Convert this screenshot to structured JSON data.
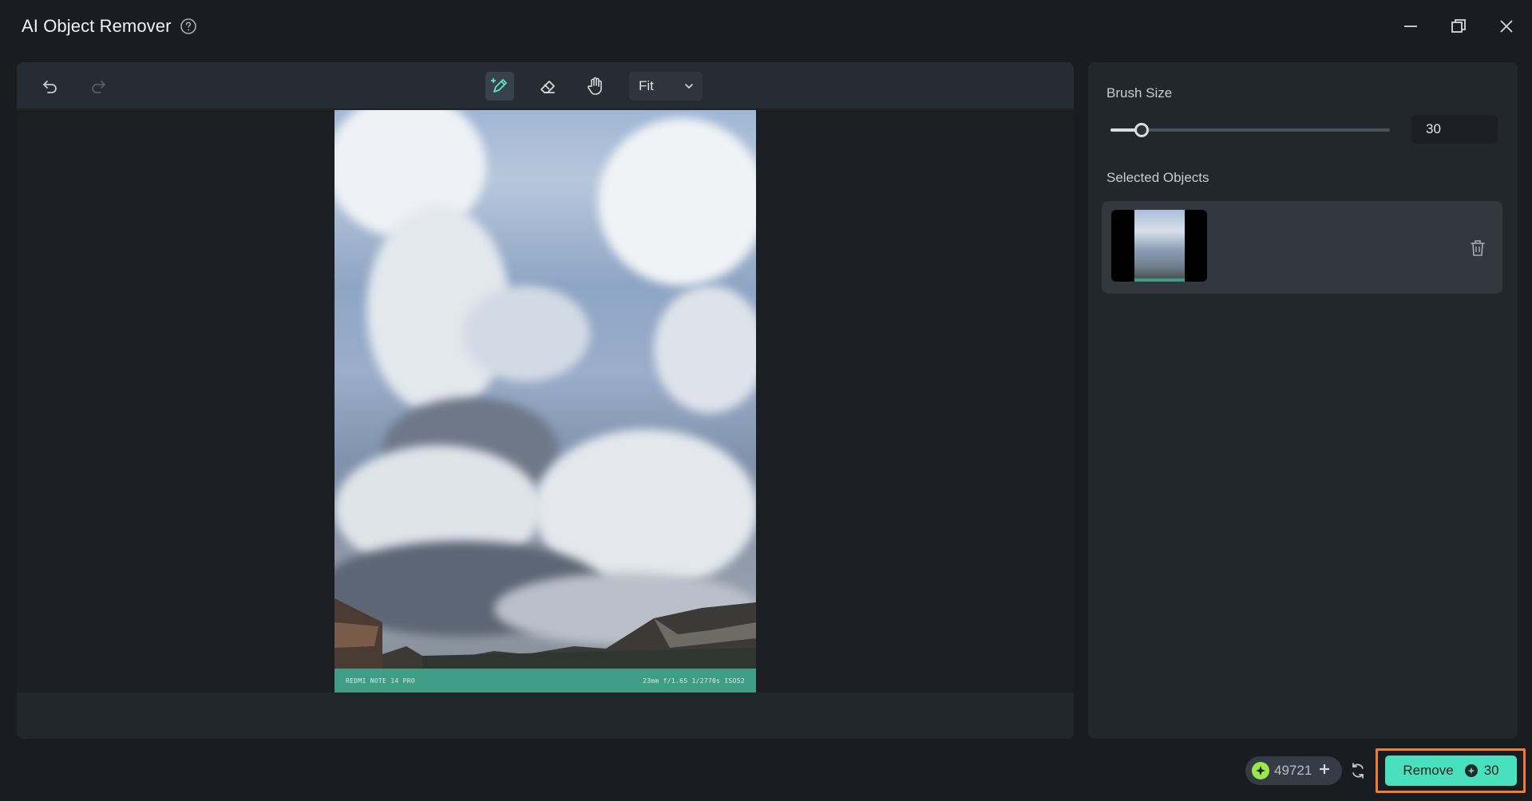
{
  "window": {
    "title": "AI Object Remover",
    "help_icon": "help-circle-icon",
    "controls": [
      "minimize-icon",
      "restore-icon",
      "close-icon"
    ]
  },
  "toolbar": {
    "undo_icon": "undo-icon",
    "redo_icon": "redo-icon",
    "tools": [
      "brush-icon",
      "eraser-icon",
      "hand-icon"
    ],
    "active_tool": "brush",
    "zoom_value": "Fit"
  },
  "photo": {
    "footer_left": "REDMI NOTE 14 PRO",
    "footer_right": "23mm  f/1.65  1/2770s  ISO52"
  },
  "side_panel": {
    "brush_size_label": "Brush Size",
    "brush_size_value": "30",
    "brush_size_fraction": 0.11,
    "selected_objects_label": "Selected Objects",
    "objects": [
      {
        "thumbnail": "object-thumbnail",
        "delete_icon": "trash-icon"
      }
    ]
  },
  "footer": {
    "credits": "49721",
    "remove_label": "Remove",
    "remove_cost": "30"
  },
  "colors": {
    "accent": "#48e0bd",
    "highlight_outline": "#f07f2d",
    "coin": "#9be84a"
  }
}
